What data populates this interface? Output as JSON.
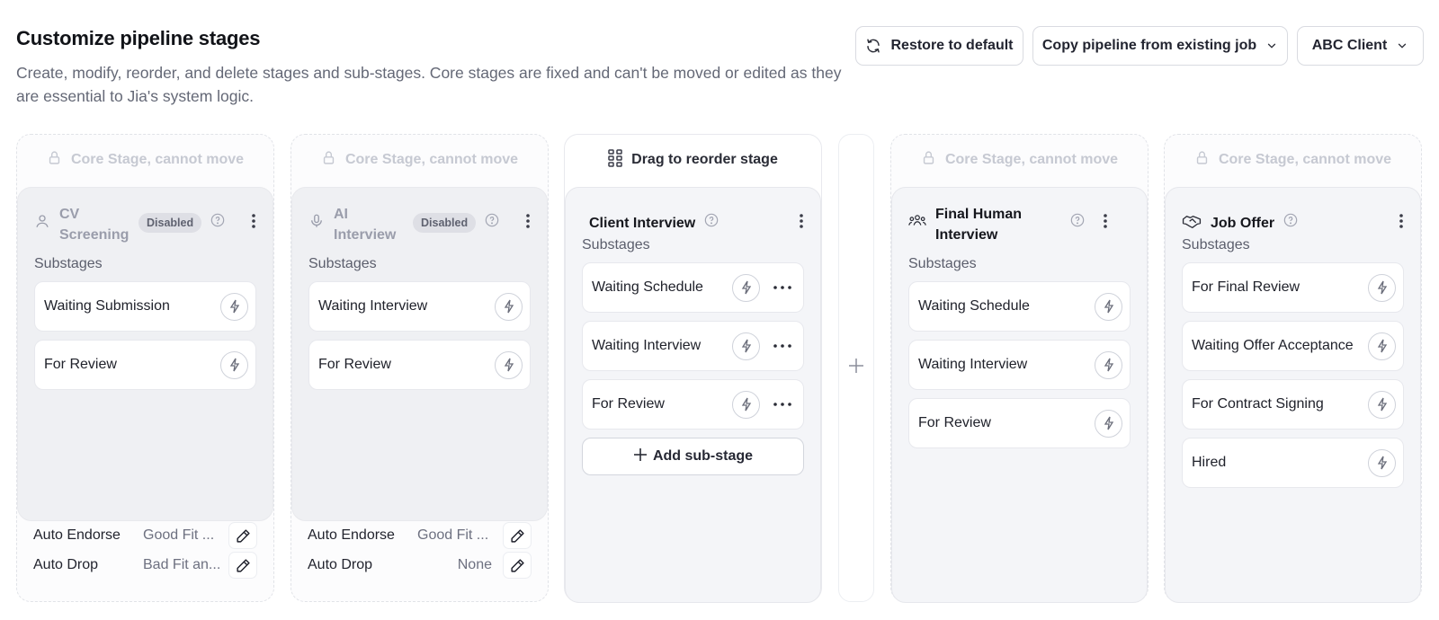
{
  "header": {
    "title": "Customize pipeline stages",
    "subtitle": "Create, modify, reorder, and delete stages and sub-stages. Core stages are fixed and can't be moved or edited as they are essential to Jia's system logic."
  },
  "toolbar": {
    "restore_label": "Restore to default",
    "copy_label": "Copy pipeline from existing job",
    "client_label": "ABC Client"
  },
  "columns": {
    "core_label": "Core Stage, cannot move",
    "drag_label": "Drag to reorder stage",
    "substages_label": "Substages",
    "add_substage_label": "Add sub-stage",
    "cv": {
      "name": "CV Screening",
      "badge": "Disabled",
      "substages": [
        "Waiting Submission",
        "For Review"
      ],
      "auto_endorse_label": "Auto Endorse",
      "auto_endorse_value": "Good Fit ...",
      "auto_drop_label": "Auto Drop",
      "auto_drop_value": "Bad Fit an..."
    },
    "ai": {
      "name": "AI Interview",
      "badge": "Disabled",
      "substages": [
        "Waiting Interview",
        "For Review"
      ],
      "auto_endorse_label": "Auto Endorse",
      "auto_endorse_value": "Good Fit ...",
      "auto_drop_label": "Auto Drop",
      "auto_drop_value": "None"
    },
    "client": {
      "name": "Client Interview",
      "substages": [
        "Waiting Schedule",
        "Waiting Interview",
        "For Review"
      ]
    },
    "final": {
      "name": "Final Human Interview",
      "substages": [
        "Waiting Schedule",
        "Waiting Interview",
        "For Review"
      ]
    },
    "offer": {
      "name": "Job Offer",
      "substages": [
        "For Final Review",
        "Waiting Offer Acceptance",
        "For Contract Signing",
        "Hired"
      ]
    }
  },
  "colors": {
    "accent_text": "#111318",
    "muted_text": "#646876",
    "core_header_text": "#c6c9d2",
    "card_bg": "#f4f5f8"
  }
}
